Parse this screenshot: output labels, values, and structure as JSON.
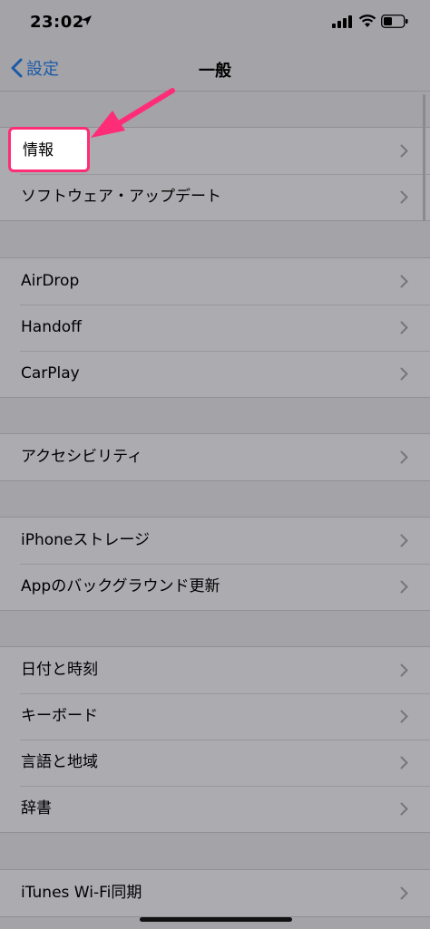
{
  "status_bar": {
    "time": "23:02"
  },
  "nav": {
    "back_label": "設定",
    "title": "一般"
  },
  "groups": [
    {
      "items": [
        {
          "label": "情報"
        },
        {
          "label": "ソフトウェア・アップデート"
        }
      ]
    },
    {
      "items": [
        {
          "label": "AirDrop"
        },
        {
          "label": "Handoff"
        },
        {
          "label": "CarPlay"
        }
      ]
    },
    {
      "items": [
        {
          "label": "アクセシビリティ"
        }
      ]
    },
    {
      "items": [
        {
          "label": "iPhoneストレージ"
        },
        {
          "label": "Appのバックグラウンド更新"
        }
      ]
    },
    {
      "items": [
        {
          "label": "日付と時刻"
        },
        {
          "label": "キーボード"
        },
        {
          "label": "言語と地域"
        },
        {
          "label": "辞書"
        }
      ]
    },
    {
      "items": [
        {
          "label": "iTunes Wi-Fi同期"
        }
      ]
    }
  ],
  "colors": {
    "highlight": "#ff2d76",
    "link": "#1a5aa8"
  }
}
